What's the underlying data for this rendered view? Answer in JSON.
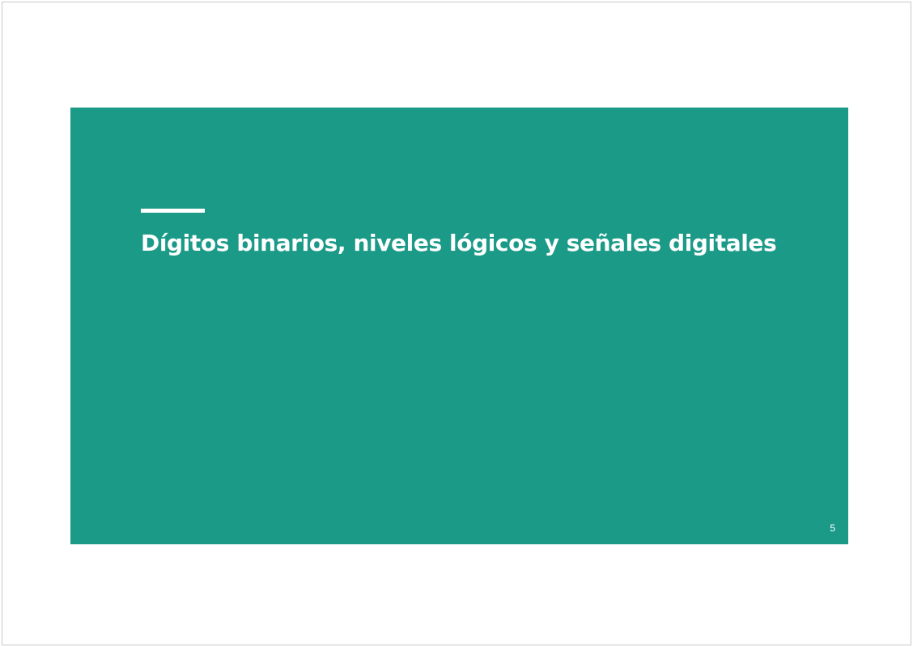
{
  "slide": {
    "title": "Dígitos binarios, niveles lógicos y señales digitales",
    "page_number": "5",
    "background_color": "#1b9a88",
    "accent_color": "#ffffff"
  }
}
